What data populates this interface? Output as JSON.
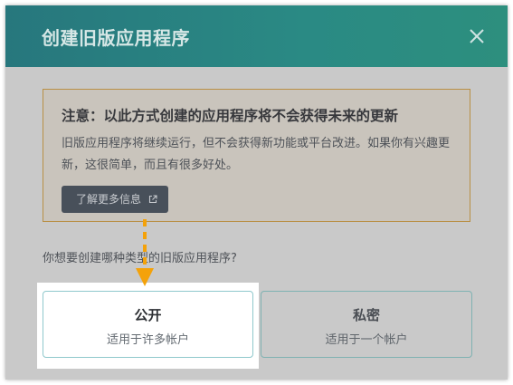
{
  "dialog": {
    "title": "创建旧版应用程序",
    "close_icon": "close-icon"
  },
  "notice": {
    "title": "注意：以此方式创建的应用程序将不会获得未来的更新",
    "body": "旧版应用程序将继续运行，但不会获得新功能或平台改进。如果你有兴趣更新，这很简单，而且有很多好处。",
    "learn_more_label": "了解更多信息",
    "learn_more_icon": "external-link-icon"
  },
  "question": "你想要创建哪种类型的旧版应用程序?",
  "options": [
    {
      "label": "公开",
      "description": "适用于许多帐户"
    },
    {
      "label": "私密",
      "description": "适用于一个帐户"
    }
  ],
  "colors": {
    "header_start": "#27777d",
    "header_end": "#2d8f7e",
    "notice_border": "#b98f45",
    "arrow": "#f4a20a",
    "card_border": "#8fc8cc"
  }
}
